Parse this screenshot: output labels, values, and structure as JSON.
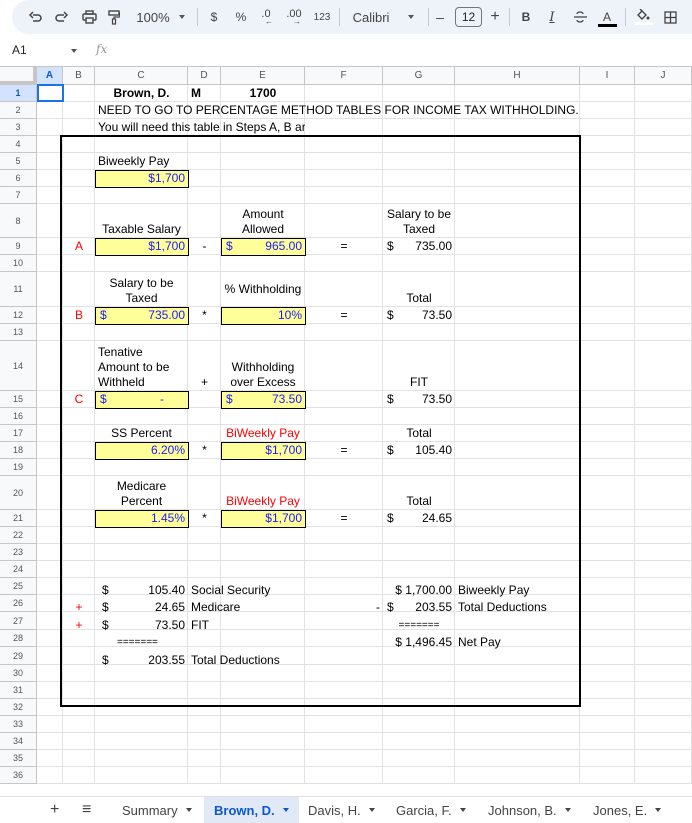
{
  "toolbar": {
    "zoom": "100%",
    "currency_label": "$",
    "percent_label": "%",
    "decrease_decimal_label": ".0",
    "increase_decimal_label": ".00",
    "more_formats_label": "123",
    "font": "Calibri",
    "font_size": "12",
    "minus_label": "–",
    "plus_label": "+",
    "bold_label": "B",
    "italic_label": "I",
    "text_color_label": "A",
    "colors": {
      "toolbar_bg": "#eef2f9",
      "text_color_bar": "#000000",
      "fill_color_bar": "#ffffff"
    }
  },
  "formula_bar": {
    "cell_ref": "A1",
    "fx": "fx",
    "value": ""
  },
  "columns": [
    "A",
    "B",
    "C",
    "D",
    "E",
    "F",
    "G",
    "H",
    "I",
    "J"
  ],
  "selected_column": "A",
  "rows": [
    "1",
    "2",
    "3",
    "4",
    "5",
    "6",
    "7",
    "8",
    "9",
    "10",
    "11",
    "12",
    "13",
    "14",
    "15",
    "16",
    "17",
    "18",
    "19",
    "20",
    "21",
    "22",
    "23",
    "24",
    "25",
    "26",
    "27",
    "28",
    "29",
    "30",
    "31",
    "32",
    "33",
    "34",
    "35",
    "36"
  ],
  "selected_row": "1",
  "sheet": {
    "c1": "Brown, D.",
    "d1": "M",
    "e1": "1700",
    "c2": "NEED TO GO TO PERCENTAGE METHOD TABLES FOR INCOME TAX WITHHOLDING.",
    "c3": "You will need this table in Steps A, B ar",
    "c5": "Biweekly Pay",
    "c6": "$1,700",
    "e8": "Amount Allowed",
    "c8": "Taxable Salary",
    "g8": "Salary to be Taxed",
    "b9": "A",
    "c9": "$1,700",
    "d9": "-",
    "e9_sym": "$",
    "e9": "965.00",
    "f9": "=",
    "g9_sym": "$",
    "g9": "735.00",
    "c11": "Salary to be Taxed",
    "e11": "% Withholding",
    "g11": "Total",
    "b12": "B",
    "c12_sym": "$",
    "c12": "735.00",
    "d12": "*",
    "e12": "10%",
    "f12": "=",
    "g12_sym": "$",
    "g12": "73.50",
    "c14": "Tenative Amount to be Withheld",
    "d14": "+",
    "e14": "Withholding over Excess",
    "g14": "FIT",
    "b15": "C",
    "c15_sym": "$",
    "c15": "-",
    "e15_sym": "$",
    "e15": "73.50",
    "g15_sym": "$",
    "g15": "73.50",
    "c17": "SS Percent",
    "e17": "BiWeekly Pay",
    "g17": "Total",
    "c18": "6.20%",
    "d18": "*",
    "e18": "$1,700",
    "f18": "=",
    "g18_sym": "$",
    "g18": "105.40",
    "c20": "Medicare Percent",
    "e20": "BiWeekly Pay",
    "g20": "Total",
    "c21": "1.45%",
    "d21": "*",
    "e21": "$1,700",
    "f21": "=",
    "g21_sym": "$",
    "g21": "24.65",
    "c25_sym": "$",
    "c25": "105.40",
    "d25": "Social Security",
    "b26": "+",
    "c26_sym": "$",
    "c26": "24.65",
    "d26": "Medicare",
    "b27": "+",
    "c27_sym": "$",
    "c27": "73.50",
    "d27": "FIT",
    "c28": "=======",
    "c29_sym": "$",
    "c29": "203.55",
    "d29": "Total Deductions",
    "g25": "$ 1,700.00",
    "h25": "Biweekly Pay",
    "f26": "-",
    "g26_sym": "$",
    "g26": "203.55",
    "h26": "Total Deductions",
    "g27": "=======",
    "g28": "$ 1,496.45",
    "h28": "Net Pay"
  },
  "colors": {
    "input_fill": "#ffff99",
    "input_text": "#1a1aff",
    "step_label": "#ff0000",
    "selection": "#1a73e8"
  },
  "tabs": {
    "add_label": "+",
    "list_label": "≡",
    "items": [
      {
        "label": "Summary",
        "active": false
      },
      {
        "label": "Brown, D.",
        "active": true
      },
      {
        "label": "Davis, H.",
        "active": false
      },
      {
        "label": "Garcia, F.",
        "active": false
      },
      {
        "label": "Johnson, B.",
        "active": false
      },
      {
        "label": "Jones, E.",
        "active": false
      }
    ]
  }
}
